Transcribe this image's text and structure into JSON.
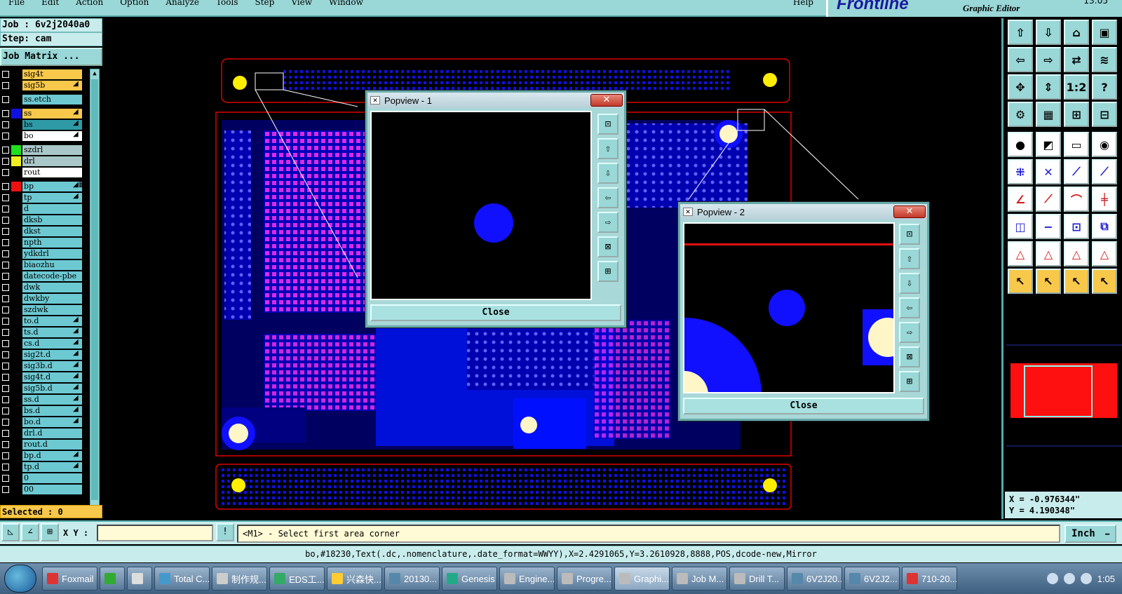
{
  "menubar": {
    "items": [
      "File",
      "Edit",
      "Action",
      "Option",
      "Analyze",
      "Tools",
      "Step",
      "View",
      "Window"
    ],
    "help": "Help"
  },
  "brand": {
    "logo": "Frontline",
    "subtitle": "Graphic Editor",
    "time": "13:05"
  },
  "left_panel": {
    "job": "Job : 6v2j2040a0",
    "step": "Step: cam",
    "job_matrix": "Job Matrix ...",
    "layers": [
      {
        "name": "sig4t",
        "style": "hl",
        "swatch": ""
      },
      {
        "name": "sig5b",
        "style": "hl",
        "swatch": "",
        "flag": "◢"
      },
      {
        "gap": true
      },
      {
        "name": "ss.etch",
        "style": "",
        "swatch": ""
      },
      {
        "gap": true
      },
      {
        "name": "ss",
        "style": "hl",
        "swatch": "#1010e0",
        "flag": "◢"
      },
      {
        "name": "bs",
        "style": "db",
        "swatch": "",
        "flag": "◢"
      },
      {
        "name": "bo",
        "style": "w",
        "swatch": "",
        "flag": "◢"
      },
      {
        "gap": true
      },
      {
        "name": "szdrl",
        "style": "g",
        "swatch": "#20e020"
      },
      {
        "name": "drl",
        "style": "g",
        "swatch": "#f0f020"
      },
      {
        "name": "rout",
        "style": "w",
        "swatch": ""
      },
      {
        "gap": true
      },
      {
        "name": "bp",
        "style": "",
        "swatch": "#f01010",
        "flag": "◢▦"
      },
      {
        "name": "tp",
        "style": "",
        "swatch": "",
        "flag": "◢"
      },
      {
        "name": "d",
        "style": "",
        "swatch": ""
      },
      {
        "name": "dksb",
        "style": "",
        "swatch": ""
      },
      {
        "name": "dkst",
        "style": "",
        "swatch": ""
      },
      {
        "name": "npth",
        "style": "",
        "swatch": ""
      },
      {
        "name": "ydkdrl",
        "style": "",
        "swatch": ""
      },
      {
        "name": "biaozhu",
        "style": "",
        "swatch": ""
      },
      {
        "name": "datecode-pbe",
        "style": "",
        "swatch": ""
      },
      {
        "name": "dwk",
        "style": "",
        "swatch": ""
      },
      {
        "name": "dwkby",
        "style": "",
        "swatch": ""
      },
      {
        "name": "szdwk",
        "style": "",
        "swatch": ""
      },
      {
        "name": "to.d",
        "style": "",
        "swatch": "",
        "flag": "◢"
      },
      {
        "name": "ts.d",
        "style": "",
        "swatch": "",
        "flag": "◢"
      },
      {
        "name": "cs.d",
        "style": "",
        "swatch": "",
        "flag": "◢"
      },
      {
        "name": "sig2t.d",
        "style": "",
        "swatch": "",
        "flag": "◢"
      },
      {
        "name": "sig3b.d",
        "style": "",
        "swatch": "",
        "flag": "◢"
      },
      {
        "name": "sig4t.d",
        "style": "",
        "swatch": "",
        "flag": "◢"
      },
      {
        "name": "sig5b.d",
        "style": "",
        "swatch": "",
        "flag": "◢"
      },
      {
        "name": "ss.d",
        "style": "",
        "swatch": "",
        "flag": "◢"
      },
      {
        "name": "bs.d",
        "style": "",
        "swatch": "",
        "flag": "◢"
      },
      {
        "name": "bo.d",
        "style": "",
        "swatch": "",
        "flag": "◢"
      },
      {
        "name": "drl.d",
        "style": "",
        "swatch": ""
      },
      {
        "name": "rout.d",
        "style": "",
        "swatch": ""
      },
      {
        "name": "bp.d",
        "style": "",
        "swatch": "",
        "flag": "◢"
      },
      {
        "name": "tp.d",
        "style": "",
        "swatch": "",
        "flag": "◢"
      },
      {
        "name": "0",
        "style": "",
        "swatch": ""
      },
      {
        "name": "00",
        "style": "",
        "swatch": ""
      }
    ],
    "selected": "Selected : 0"
  },
  "popview1": {
    "title": "Popview - 1",
    "close_x": "✕",
    "close_button": "Close"
  },
  "popview2": {
    "title": "Popview - 2",
    "close_x": "✕",
    "close_button": "Close"
  },
  "popview_tool_icons": [
    "zoom-fit-icon",
    "pan-up-icon",
    "pan-down-icon",
    "pan-left-icon",
    "pan-right-icon",
    "zoom-out-icon",
    "zoom-in-icon"
  ],
  "right_panel": {
    "tools": [
      [
        "⇧",
        "⇩",
        "⌂",
        "▣"
      ],
      [
        "⇦",
        "⇨",
        "⇄",
        "≋"
      ],
      [
        "✥",
        "⇕",
        "1:2",
        "?"
      ],
      [
        "⚙",
        "▦",
        "⊞",
        "⊟"
      ],
      [
        "●",
        "◩",
        "▭",
        "◉"
      ],
      [
        "⁜",
        "✕",
        "⟋",
        "⟋"
      ],
      [
        "∠",
        "⟋",
        "⌒",
        "╪"
      ],
      [
        "◫",
        "−",
        "⊡",
        "⧉"
      ],
      [
        "△",
        "△",
        "△",
        "△"
      ],
      [
        "↖",
        "↖",
        "↖",
        "↖"
      ]
    ],
    "coord_x": "X = -0.976344\"",
    "coord_y": "Y = 4.190348\""
  },
  "cmdbar": {
    "xy_label": "X Y :",
    "xy_value": "",
    "prompt": "<M1> - Select first area corner",
    "units": "Inch"
  },
  "status_line": "bo,#18230,Text(.dc,.nomenclature,.date_format=WWYY),X=2.4291065,Y=3.2610928,8888,POS,dcode-new,Mirror",
  "taskbar": {
    "items": [
      {
        "label": "Foxmail",
        "color": "#d33"
      },
      {
        "label": "",
        "color": "#3a3"
      },
      {
        "label": "",
        "color": "#ddd"
      },
      {
        "label": "Total C...",
        "color": "#49c"
      },
      {
        "label": "制作规...",
        "color": "#ccc"
      },
      {
        "label": "EDS工...",
        "color": "#3a6"
      },
      {
        "label": "兴森快...",
        "color": "#fc3"
      },
      {
        "label": "20130...",
        "color": "#58a"
      },
      {
        "label": "Genesis",
        "color": "#2a8"
      },
      {
        "label": "Engine...",
        "color": "#bbb"
      },
      {
        "label": "Progre...",
        "color": "#bbb"
      },
      {
        "label": "Graphi...",
        "color": "#bbb",
        "active": true
      },
      {
        "label": "Job M...",
        "color": "#bbb"
      },
      {
        "label": "Drill T...",
        "color": "#bbb"
      },
      {
        "label": "6V2J20...",
        "color": "#58a"
      },
      {
        "label": "6V2J2...",
        "color": "#58a"
      },
      {
        "label": "710-20...",
        "color": "#d33"
      }
    ],
    "clock": "1:05"
  }
}
